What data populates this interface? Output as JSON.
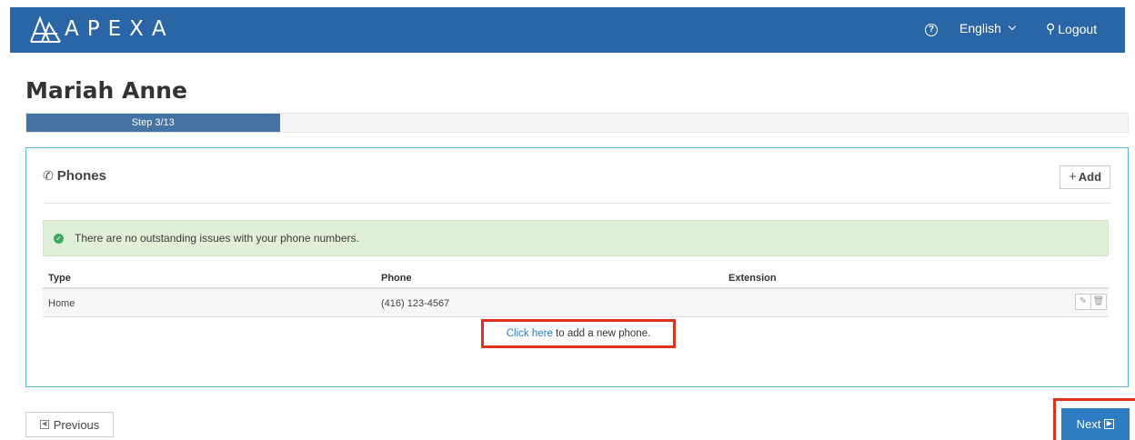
{
  "header": {
    "logo_text": "APEXA",
    "language": "English",
    "logout_label": "Logout",
    "colors": {
      "bar": "#2a65a5"
    }
  },
  "page": {
    "title": "Mariah Anne",
    "step_label": "Step 3/13",
    "step_progress": 0.23
  },
  "phones_panel": {
    "title": "Phones",
    "add_label": "Add",
    "alert_text": "There are no outstanding issues with your phone numbers.",
    "columns": [
      "Type",
      "Phone",
      "Extension"
    ],
    "rows": [
      {
        "type": "Home",
        "phone": "(416) 123-4567",
        "extension": ""
      }
    ],
    "add_hint": {
      "link_text": "Click here",
      "rest_text": " to add a new phone."
    }
  },
  "footer": {
    "previous_label": "Previous",
    "next_label": "Next"
  }
}
